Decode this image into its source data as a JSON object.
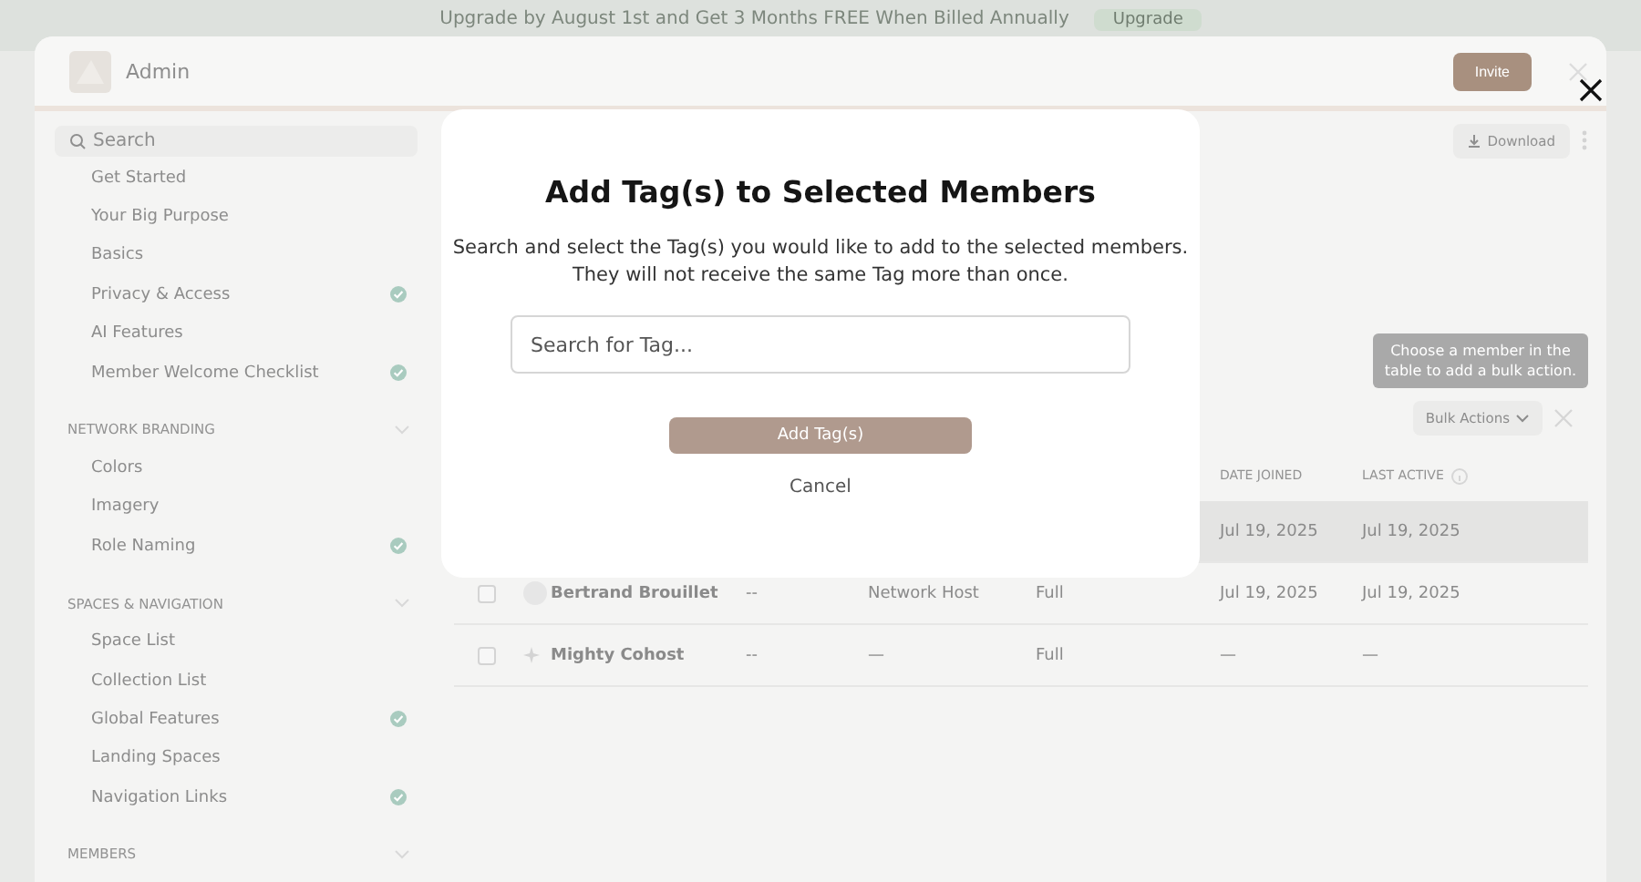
{
  "banner": {
    "text": "Upgrade by August 1st and Get 3 Months FREE When Billed Annually",
    "button": "Upgrade"
  },
  "window": {
    "title": "Admin",
    "invite": "Invite"
  },
  "sidebar": {
    "search": {
      "placeholder": "Search"
    },
    "groups": [
      {
        "items": [
          {
            "label": "Get Started",
            "checked": false
          },
          {
            "label": "Your Big Purpose",
            "checked": false
          },
          {
            "label": "Basics",
            "checked": false
          },
          {
            "label": "Privacy & Access",
            "checked": true
          },
          {
            "label": "AI Features",
            "checked": false
          },
          {
            "label": "Member Welcome Checklist",
            "checked": true
          }
        ]
      },
      {
        "heading": "NETWORK BRANDING",
        "items": [
          {
            "label": "Colors",
            "checked": false
          },
          {
            "label": "Imagery",
            "checked": false
          },
          {
            "label": "Role Naming",
            "checked": true
          }
        ]
      },
      {
        "heading": "SPACES & NAVIGATION",
        "items": [
          {
            "label": "Space List",
            "checked": false
          },
          {
            "label": "Collection List",
            "checked": false
          },
          {
            "label": "Global Features",
            "checked": true
          },
          {
            "label": "Landing Spaces",
            "checked": false
          },
          {
            "label": "Navigation Links",
            "checked": true
          }
        ]
      },
      {
        "heading": "MEMBERS"
      }
    ]
  },
  "main": {
    "download": "Download",
    "tooltip": "Choose a member in the table to add a bulk action.",
    "bulk_actions": "Bulk Actions",
    "columns": [
      "DATE JOINED",
      "LAST ACTIVE"
    ],
    "rows": [
      {
        "shaded": true,
        "date_joined": "Jul 19, 2025",
        "last_active": "Jul 19, 2025"
      },
      {
        "shaded": false,
        "kind": "person",
        "name": "Bertrand Brouillet",
        "column_2": "--",
        "column_3": "Network Host",
        "column_4": "Full",
        "date_joined": "Jul 19, 2025",
        "last_active": "Jul 19, 2025"
      },
      {
        "shaded": false,
        "kind": "sparkle",
        "name": "Mighty Cohost",
        "column_2": "--",
        "column_3": "—",
        "column_4": "Full",
        "date_joined": "—",
        "last_active": "—"
      }
    ]
  },
  "modal": {
    "title": "Add Tag(s) to Selected Members",
    "description": [
      "Search and select the Tag(s) you would like to add to the selected members.",
      "They will not receive the same Tag more than once."
    ],
    "search": {
      "placeholder": "Search for Tag..."
    },
    "primary": "Add Tag(s)",
    "cancel": "Cancel"
  }
}
